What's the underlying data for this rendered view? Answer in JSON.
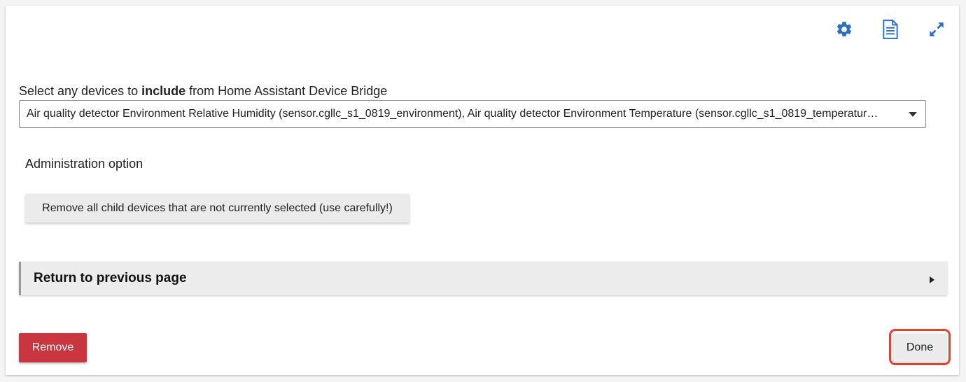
{
  "toolbar": {
    "icons": [
      "gear-icon",
      "document-icon",
      "expand-icon"
    ],
    "icon_color": "#2a6ec8"
  },
  "device_select": {
    "label_prefix": "Select any devices to ",
    "label_bold": "include",
    "label_suffix": " from Home Assistant Device Bridge",
    "value": "Air quality detector Environment Relative Humidity (sensor.cgllc_s1_0819_environment), Air quality detector Environment Temperature (sensor.cgllc_s1_0819_temperatur…"
  },
  "admin": {
    "title": "Administration option",
    "remove_children_label": "Remove all child devices that are not currently selected (use carefully!)"
  },
  "return_section": {
    "label": "Return to previous page"
  },
  "footer": {
    "remove_label": "Remove",
    "done_label": "Done",
    "remove_color": "#c9363f",
    "highlight_color": "#e5432b"
  }
}
